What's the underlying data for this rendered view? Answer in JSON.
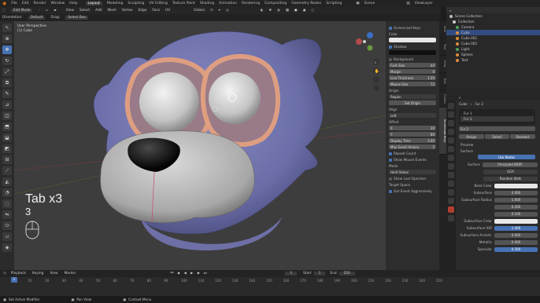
{
  "menubar": {
    "items": [
      "File",
      "Edit",
      "Render",
      "Window",
      "Help"
    ],
    "workspaces": [
      "Layout",
      "Modeling",
      "Sculpting",
      "UV Editing",
      "Texture Paint",
      "Shading",
      "Animation",
      "Rendering",
      "Compositing",
      "Geometry Nodes",
      "Scripting"
    ],
    "active_workspace": "Layout",
    "scene": "Scene",
    "view_layer": "ViewLayer"
  },
  "header": {
    "mode": "Edit Mode",
    "menus": [
      "View",
      "Select",
      "Add",
      "Mesh",
      "Vertex",
      "Edge",
      "Face",
      "UV"
    ],
    "orientation_label": "Orientation:",
    "orientation": "Default",
    "drag_label": "Drag:",
    "drag": "Select Box",
    "transform": "Global"
  },
  "viewport": {
    "view_name": "User Perspective",
    "object_name": "(1) Cube",
    "overlay_text_1": "Tab x3",
    "overlay_text_2": "3"
  },
  "npanel": {
    "screencast_keys": "Screencast Keys",
    "color_label": "Color",
    "shadow_label": "Shadow",
    "background_label": "Background",
    "fields": [
      {
        "label": "Font Size",
        "value": "44"
      },
      {
        "label": "Margin",
        "value": "0"
      },
      {
        "label": "Line Thickness",
        "value": "1.00"
      },
      {
        "label": "Mouse Size",
        "value": "72"
      }
    ],
    "origin_label": "Origin",
    "origin_value": "Region",
    "set_origin": "Set Origin",
    "align_label": "Align",
    "align_value": "Left",
    "offset_label": "Offset",
    "offset_fields": [
      {
        "label": "X",
        "value": "20"
      },
      {
        "label": "Y",
        "value": "80"
      },
      {
        "label": "Display Time",
        "value": "3.00"
      },
      {
        "label": "Max Event History",
        "value": "5"
      }
    ],
    "repeat_count": "Repeat Count",
    "show_mouse_events": "Show Mouse Events",
    "mode_label": "Mode",
    "mode_value": "Hold Status",
    "show_last_operator": "Show Last Operator",
    "target_label": "Target Space",
    "get_event": "Get Event Aggressively"
  },
  "vtabs": [
    "Item",
    "Tool",
    "View",
    "Edit",
    "Create",
    "Screencast Keys"
  ],
  "outliner": {
    "title": "Scene Collection",
    "items": [
      {
        "name": "Collection",
        "color": "#cfcfcf"
      },
      {
        "name": "Camera",
        "color": "#4fa35a"
      },
      {
        "name": "Cube",
        "color": "#e08e3b"
      },
      {
        "name": "Cube.001",
        "color": "#e08e3b"
      },
      {
        "name": "Cube.002",
        "color": "#e08e3b"
      },
      {
        "name": "Light",
        "color": "#4fa35a"
      },
      {
        "name": "Sphere",
        "color": "#e08e3b"
      },
      {
        "name": "Text",
        "color": "#e08e3b"
      }
    ]
  },
  "properties": {
    "breadcrumb_obj": "Cube",
    "breadcrumb_mat": "Fur 2",
    "slots": [
      "Fur 1",
      "Fur 2"
    ],
    "material_name": "Fur 2",
    "assign_buttons": [
      "Assign",
      "Select",
      "Deselect"
    ],
    "preview_label": "Preview",
    "surface_section": "Surface",
    "use_nodes": "Use Nodes",
    "surface_label": "Surface",
    "surface_value": "Principled BSDF",
    "distribution": "GGX",
    "subsurface_method": "Random Walk",
    "rows": [
      {
        "label": "Base Color",
        "value": "",
        "style": "white"
      },
      {
        "label": "Subsurface",
        "value": "0.000",
        "style": ""
      },
      {
        "label": "Subsurface Radius",
        "value": "1.000",
        "style": ""
      },
      {
        "label": "",
        "value": "0.200",
        "style": ""
      },
      {
        "label": "",
        "value": "0.100",
        "style": ""
      },
      {
        "label": "Subsurface Color",
        "value": "",
        "style": "white"
      },
      {
        "label": "Subsurface IOR",
        "value": "1.400",
        "style": "blue"
      },
      {
        "label": "Subsurface Anisotr.",
        "value": "0.000",
        "style": ""
      },
      {
        "label": "Metallic",
        "value": "0.000",
        "style": ""
      },
      {
        "label": "Specular",
        "value": "0.500",
        "style": "blue"
      }
    ]
  },
  "timeline": {
    "menus": [
      "Playback",
      "Keying",
      "View",
      "Marker"
    ],
    "current_frame": "1",
    "start_label": "Start",
    "start": "1",
    "end_label": "End",
    "end": "250",
    "ticks": [
      "0",
      "10",
      "20",
      "30",
      "40",
      "50",
      "60",
      "70",
      "80",
      "90",
      "100",
      "110",
      "120",
      "130",
      "140",
      "150",
      "160",
      "170",
      "180",
      "190",
      "200",
      "210",
      "220",
      "230",
      "240",
      "250"
    ]
  },
  "statusbar": {
    "left": "Set Active Modifier",
    "middle": "Pan View",
    "right": "Context Menu"
  }
}
